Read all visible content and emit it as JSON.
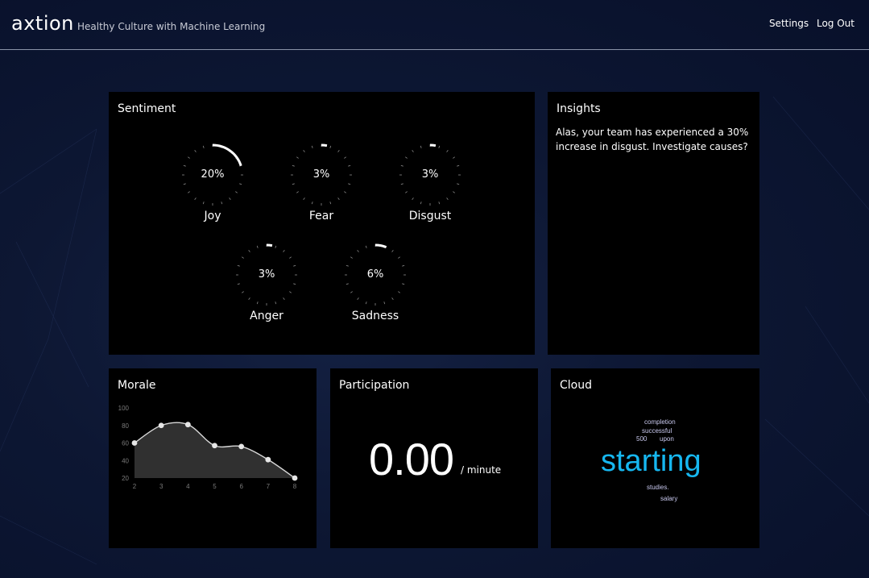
{
  "header": {
    "logo": "axtion",
    "tagline": "Healthy Culture with Machine Learning",
    "nav": [
      "Settings",
      "Log Out"
    ]
  },
  "sentiment": {
    "title": "Sentiment",
    "gauges": [
      {
        "name": "Joy",
        "percent": 20,
        "label": "20%"
      },
      {
        "name": "Fear",
        "percent": 3,
        "label": "3%"
      },
      {
        "name": "Disgust",
        "percent": 3,
        "label": "3%"
      },
      {
        "name": "Anger",
        "percent": 3,
        "label": "3%"
      },
      {
        "name": "Sadness",
        "percent": 6,
        "label": "6%"
      }
    ]
  },
  "insights": {
    "title": "Insights",
    "text": "Alas, your team has experienced a 30% increase in disgust. Investigate causes?"
  },
  "morale": {
    "title": "Morale"
  },
  "participation": {
    "title": "Participation",
    "value": "0.00",
    "unit": "/ minute"
  },
  "cloud": {
    "title": "Cloud",
    "words": [
      "completion",
      "successful",
      "500",
      "upon",
      "starting",
      "studies.",
      "salary"
    ]
  },
  "colors": {
    "background": "#0d1733",
    "panel": "#000000",
    "accent_cloud": "#16b7f0",
    "cloud_small": "#c9c9ef"
  },
  "chart_data": {
    "type": "area",
    "x": [
      2,
      3,
      4,
      5,
      6,
      7,
      8
    ],
    "series": [
      {
        "values": [
          60,
          80,
          81,
          57,
          56,
          41,
          20
        ]
      }
    ],
    "xticks": [
      "2",
      "3",
      "4",
      "5",
      "6",
      "7",
      "8"
    ],
    "yticks": [
      "20",
      "40",
      "60",
      "80",
      "100"
    ],
    "xlim": [
      2,
      8
    ],
    "ylim": [
      20,
      100
    ],
    "grid": false
  }
}
